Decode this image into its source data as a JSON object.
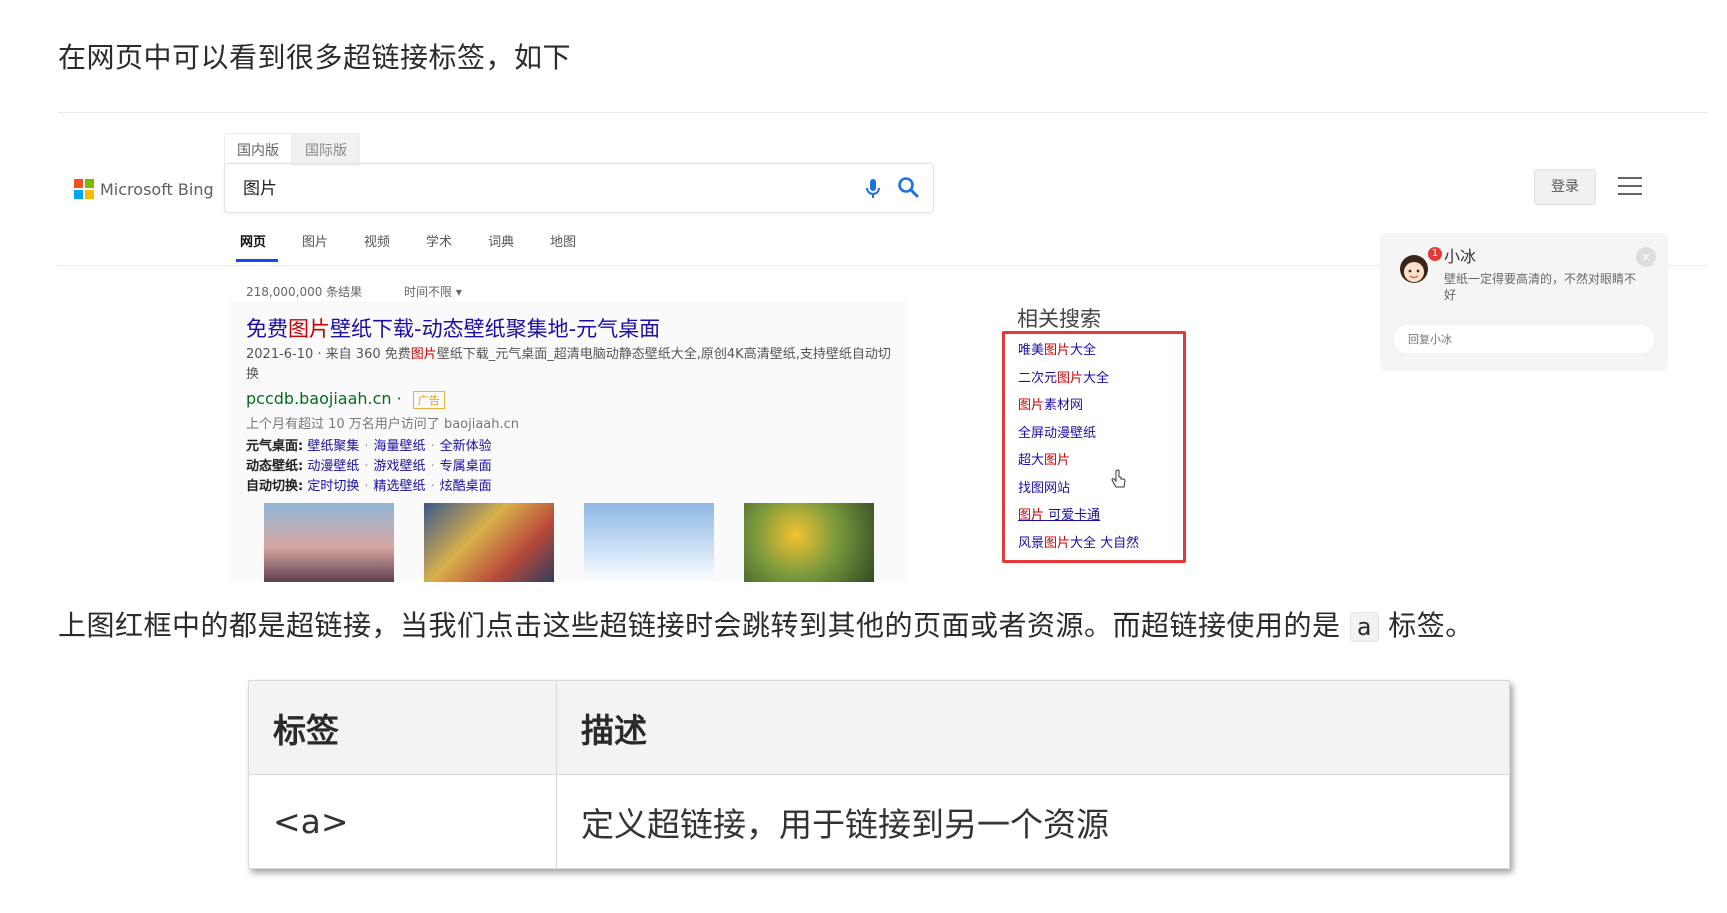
{
  "intro_text": "在网页中可以看到很多超链接标签，如下",
  "screenshot": {
    "scope_tabs": [
      "国内版",
      "国际版"
    ],
    "logo_text": "Microsoft Bing",
    "search_value": "图片",
    "login_label": "登录",
    "nav_tabs": [
      "网页",
      "图片",
      "视频",
      "学术",
      "词典",
      "地图"
    ],
    "result_count": "218,000,000 条结果",
    "time_filter": "时间不限 ▾",
    "result": {
      "title_pre": "免费",
      "title_hl": "图片",
      "title_post": "壁纸下载-动态壁纸聚集地-元气桌面",
      "snippet_pre": "2021-6-10 · 来自 360 免费",
      "snippet_hl": "图片",
      "snippet_post": "壁纸下载_元气桌面_超清电脑动静态壁纸大全,原创4K高清壁纸,支持壁纸自动切换",
      "url": "pccdb.baojiaah.cn",
      "ad_label": "广告",
      "visits": "上个月有超过 10 万名用户访问了 baojiaah.cn",
      "sublinks": [
        {
          "key": "元气桌面:",
          "links": [
            "壁纸聚集",
            "海量壁纸",
            "全新体验"
          ]
        },
        {
          "key": "动态壁纸:",
          "links": [
            "动漫壁纸",
            "游戏壁纸",
            "专属桌面"
          ]
        },
        {
          "key": "自动切换:",
          "links": [
            "定时切换",
            "精选壁纸",
            "炫酷桌面"
          ]
        }
      ]
    },
    "related_title": "相关搜索",
    "related": [
      {
        "pre": "唯美",
        "hl": "图片",
        "post": "大全"
      },
      {
        "pre": "二次元",
        "hl": "图片",
        "post": "大全"
      },
      {
        "pre": "",
        "hl": "图片",
        "post": "素材网"
      },
      {
        "pre": "全屏动漫壁纸",
        "hl": "",
        "post": ""
      },
      {
        "pre": "超大",
        "hl": "图片",
        "post": ""
      },
      {
        "pre": "找图网站",
        "hl": "",
        "post": ""
      },
      {
        "pre": "",
        "hl": "图片",
        "post": " 可爱卡通"
      },
      {
        "pre": "风景",
        "hl": "图片",
        "post": "大全 大自然"
      }
    ],
    "chat": {
      "name": "小冰",
      "badge": "1",
      "message": "壁纸一定得要高清的，不然对眼睛不好",
      "reply_placeholder": "回复小冰",
      "close": "×"
    }
  },
  "explain_pre": "上图红框中的都是超链接，当我们点击这些超链接时会跳转到其他的页面或者资源。而超链接使用的是 ",
  "explain_code": "a",
  "explain_post": " 标签。",
  "table": {
    "headers": [
      "标签",
      "描述"
    ],
    "rows": [
      [
        "<a>",
        "定义超链接，用于链接到另一个资源"
      ]
    ]
  }
}
